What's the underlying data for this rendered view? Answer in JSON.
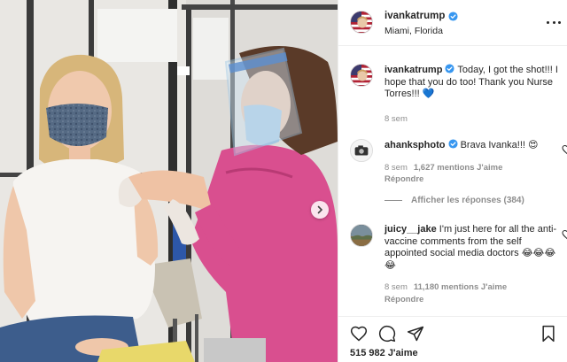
{
  "header": {
    "username": "ivankatrump",
    "location": "Miami, Florida",
    "verified_icon": "verified-badge-icon",
    "more_icon": "more-options-icon"
  },
  "caption": {
    "username": "ivankatrump",
    "text": "Today, I got the shot!!! I hope that you do too! Thank you Nurse Torres!!! 💙",
    "time": "8 sem"
  },
  "comments": [
    {
      "username": "ahanksphoto",
      "text": "Brava Ivanka!!! 😍",
      "time": "8 sem",
      "likes": "1,627 mentions J'aime",
      "reply": "Répondre",
      "verified": true
    },
    {
      "username": "juicy__jake",
      "text": "I'm just here for all the anti-vaccine comments from the self appointed social media doctors 😂😂😂😂",
      "time": "8 sem",
      "likes": "11,180 mentions J'aime",
      "reply": "Répondre",
      "verified": false
    }
  ],
  "view_replies": "Afficher les réponses (384)",
  "actions": {
    "like_icon": "heart-icon",
    "comment_icon": "comment-icon",
    "share_icon": "share-icon",
    "save_icon": "bookmark-icon"
  },
  "likes_total": "515 982 J'aime",
  "colors": {
    "verified_blue": "#3897f0",
    "text": "#262626",
    "muted": "#8e8e8e",
    "scrubs_pink": "#d94f8f"
  }
}
